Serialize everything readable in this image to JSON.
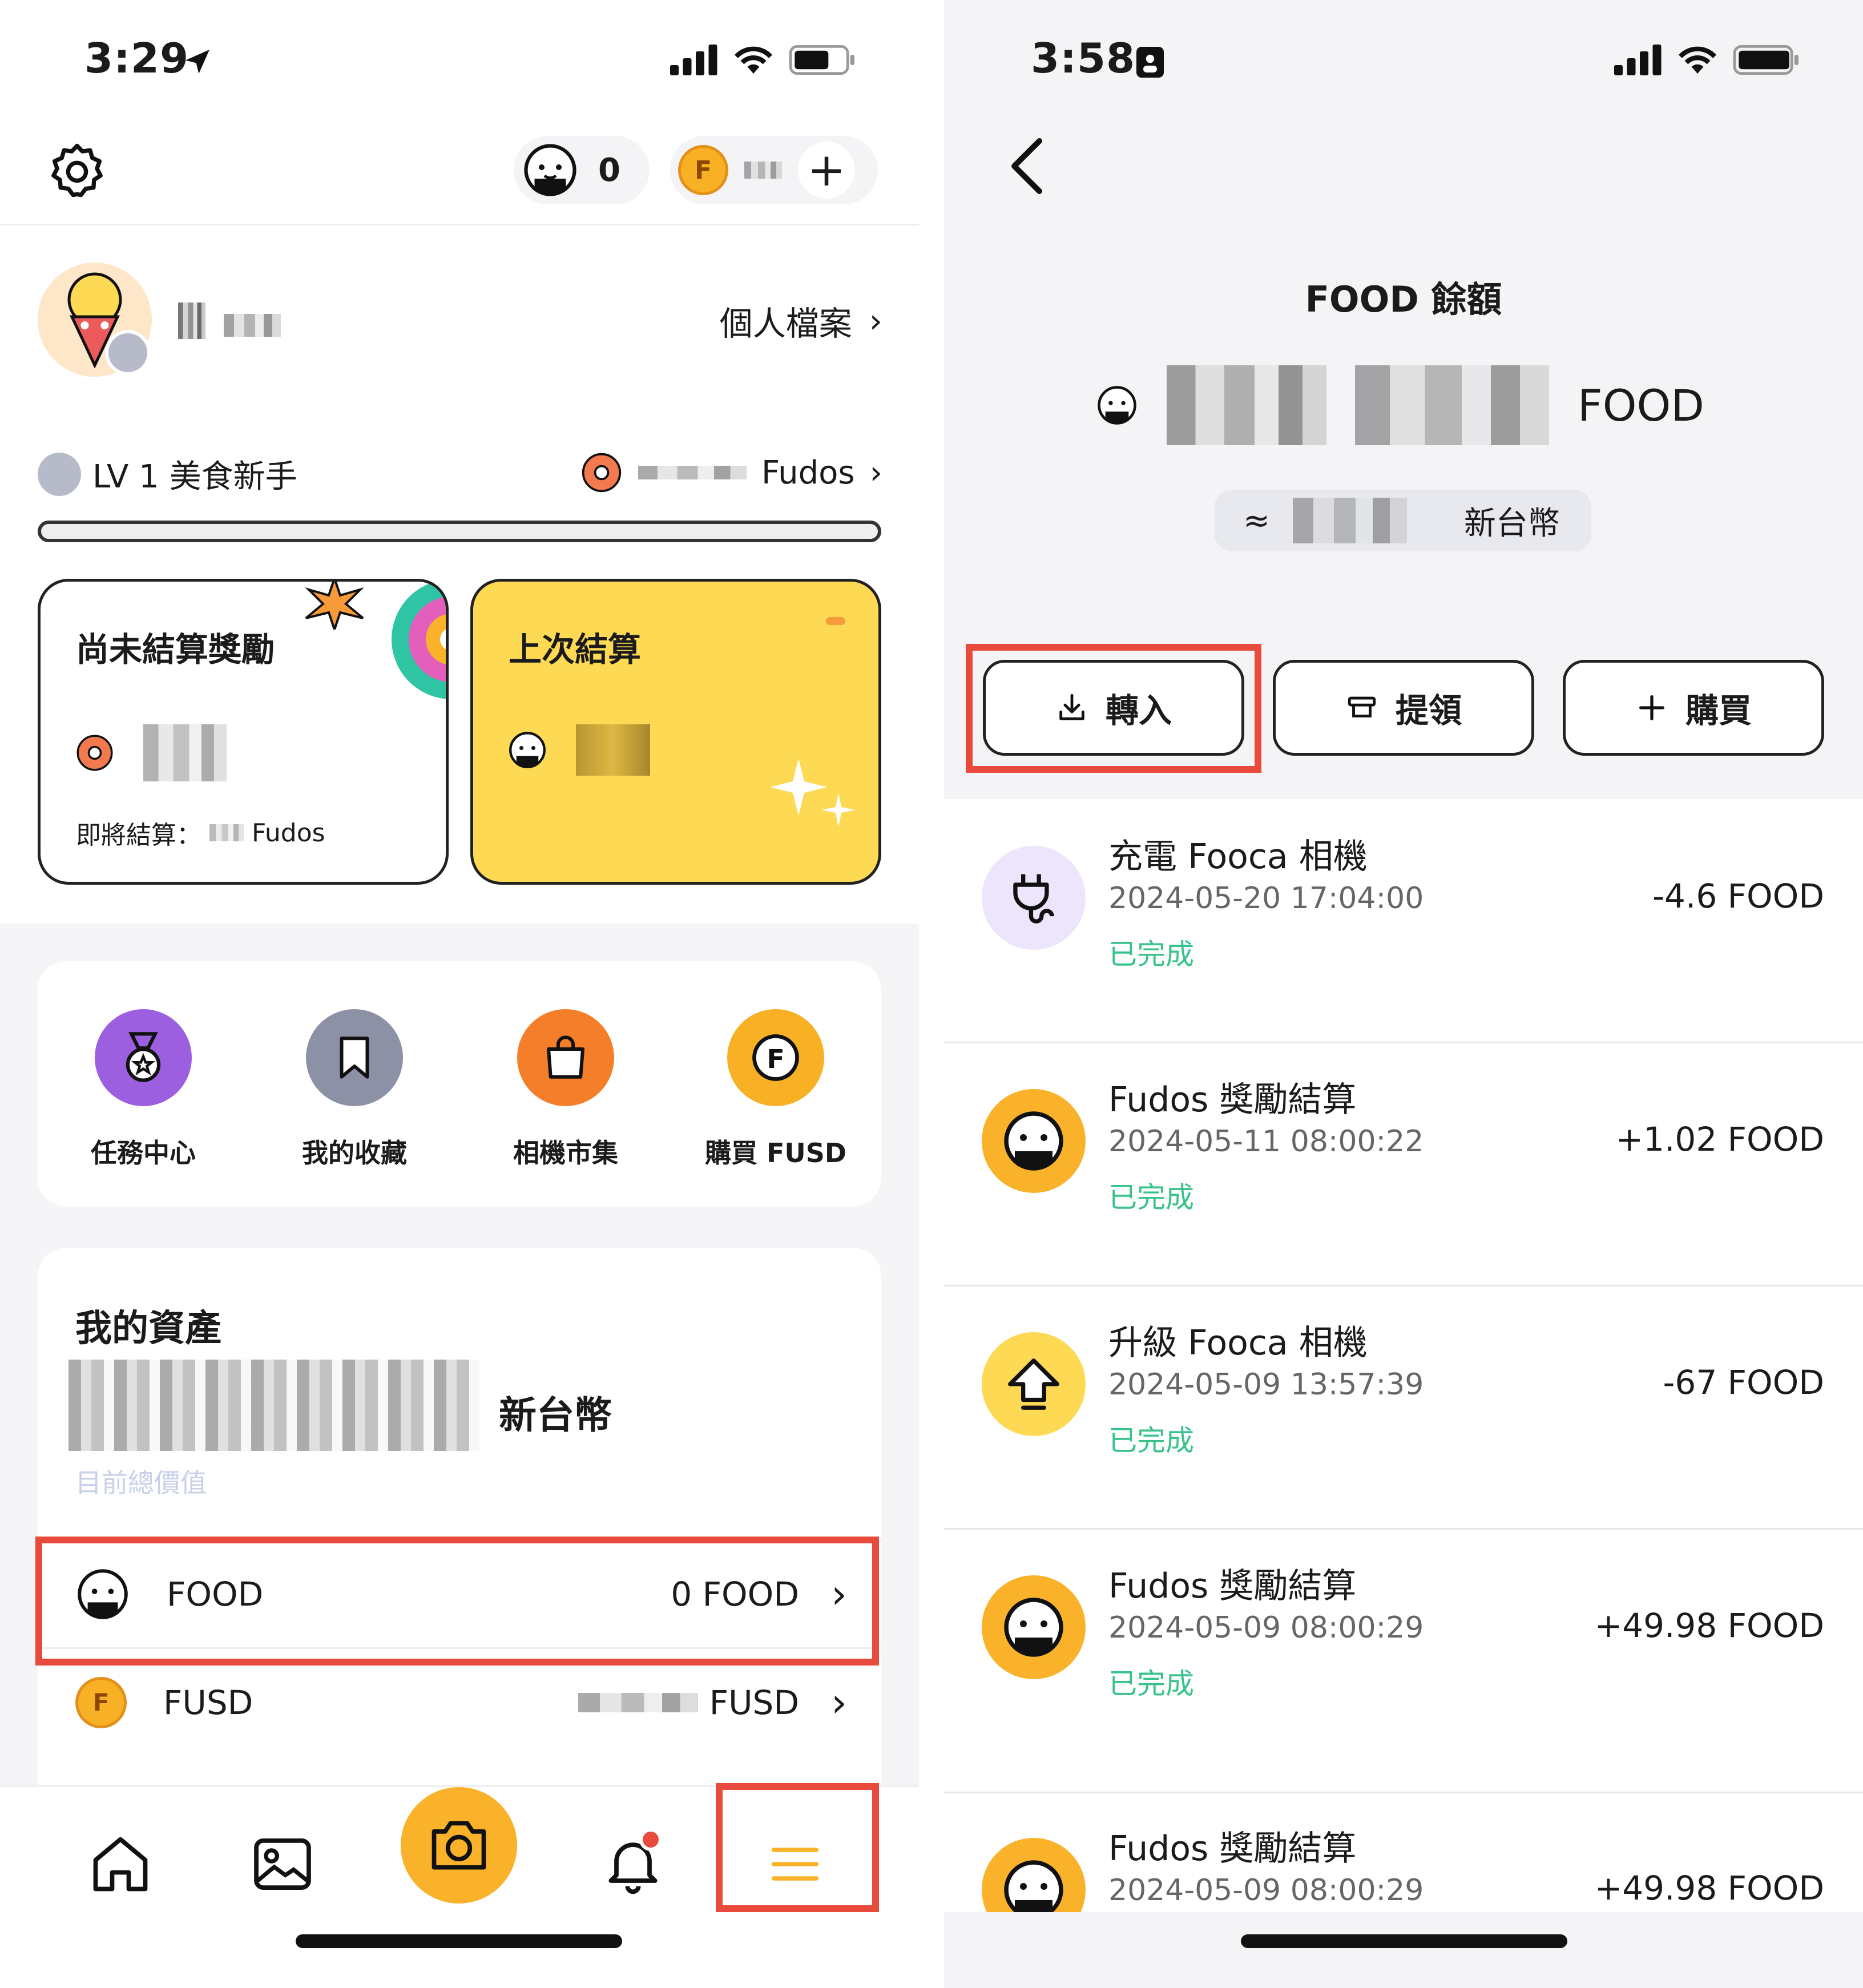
{
  "left": {
    "status": {
      "time": "3:29"
    },
    "topbar": {
      "points": "0",
      "plus": "+"
    },
    "profile": {
      "link": "個人檔案"
    },
    "level": {
      "label": "LV 1 美食新手",
      "unit": "Fudos",
      "progress": 0
    },
    "cards": {
      "pending": {
        "title": "尚未結算獎勵",
        "sub_label": "即將結算：",
        "sub_unit": "Fudos"
      },
      "last": {
        "title": "上次結算"
      }
    },
    "menu": [
      {
        "label": "任務中心",
        "icon": "medal-icon",
        "color": "#9b5fe0"
      },
      {
        "label": "我的收藏",
        "icon": "bookmark-icon",
        "color": "#8d91a6"
      },
      {
        "label": "相機市集",
        "icon": "shopping-bag-icon",
        "color": "#f57e2a"
      },
      {
        "label": "購買 FUSD",
        "icon": "fusd-coin-icon",
        "color": "#f8b024"
      }
    ],
    "assets": {
      "title": "我的資產",
      "currency": "新台幣",
      "note": "目前總價值",
      "rows": [
        {
          "name": "FOOD",
          "amount": "0 FOOD"
        },
        {
          "name": "FUSD",
          "amount": "FUSD"
        }
      ]
    },
    "tabbar": [
      "home-icon",
      "gallery-icon",
      "camera-icon",
      "bell-icon",
      "menu-icon"
    ]
  },
  "right": {
    "status": {
      "time": "3:58"
    },
    "title": "FOOD 餘額",
    "balance_unit": "FOOD",
    "fiat": {
      "approx": "≈",
      "currency": "新台幣"
    },
    "actions": {
      "deposit": "轉入",
      "withdraw": "提領",
      "buy": "購買"
    },
    "transactions": [
      {
        "title": "充電 Fooca 相機",
        "date": "2024-05-20 17:04:00",
        "status": "已完成",
        "amount": "-4.6 FOOD",
        "icon": "plug-icon"
      },
      {
        "title": "Fudos 獎勵結算",
        "date": "2024-05-11 08:00:22",
        "status": "已完成",
        "amount": "+1.02 FOOD",
        "icon": "food-coin-icon"
      },
      {
        "title": "升級 Fooca 相機",
        "date": "2024-05-09 13:57:39",
        "status": "已完成",
        "amount": "-67 FOOD",
        "icon": "upgrade-arrow-icon"
      },
      {
        "title": "Fudos 獎勵結算",
        "date": "2024-05-09 08:00:29",
        "status": "已完成",
        "amount": "+49.98 FOOD",
        "icon": "food-coin-icon"
      },
      {
        "title": "Fudos 獎勵結算",
        "date": "2024-05-09 08:00:29",
        "status": "",
        "amount": "+49.98 FOOD",
        "icon": "food-coin-icon"
      }
    ]
  },
  "colors": {
    "accent": "#f9b22a",
    "highlight": "#e84a3b",
    "success": "#39c38b",
    "card_yellow": "#fdd954"
  }
}
